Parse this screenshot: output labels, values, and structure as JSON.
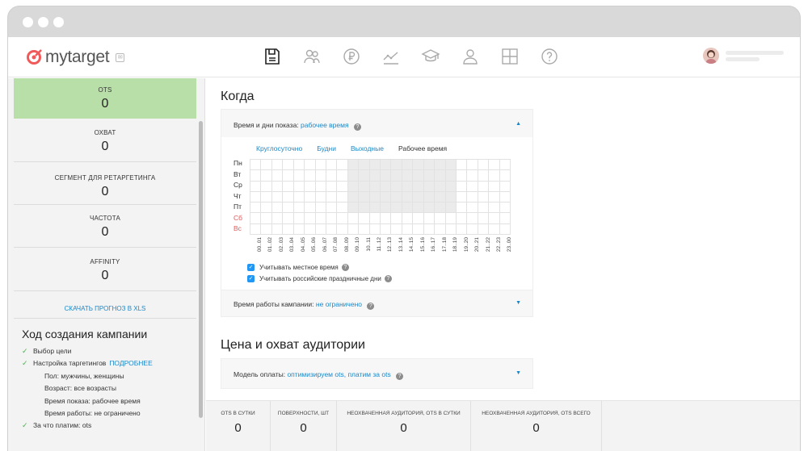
{
  "header": {
    "logo_text": "mytarget",
    "nav_icons": [
      "document-icon",
      "audience-icon",
      "ruble-icon",
      "chart-icon",
      "graduation-cap-icon",
      "profile-icon",
      "layout-icon",
      "help-icon"
    ]
  },
  "colors": {
    "accent": "#1e88c7",
    "active_stat": "#b9dfa8",
    "logo": "#f05a5a",
    "weekend": "#e05a5a"
  },
  "sidebar": {
    "stats": [
      {
        "label": "OTS",
        "value": "0"
      },
      {
        "label": "ОХВАТ",
        "value": "0"
      },
      {
        "label": "СЕГМЕНТ ДЛЯ РЕТАРГЕТИНГА",
        "value": "0"
      },
      {
        "label": "ЧАСТОТА",
        "value": "0"
      },
      {
        "label": "AFFINITY",
        "value": "0"
      }
    ],
    "download_link": "СКАЧАТЬ ПРОГНОЗ В XLS",
    "progress_title": "Ход создания кампании",
    "steps": [
      {
        "text": "Выбор цели",
        "checked": true
      },
      {
        "text": "Настройка таргетингов",
        "link": "ПОДРОБНЕЕ",
        "checked": true
      },
      {
        "text": "Пол: мужчины, женщины"
      },
      {
        "text": "Возраст: все возрасты"
      },
      {
        "text": "Время показа: рабочее время"
      },
      {
        "text": "Время работы: не ограничено"
      },
      {
        "text": "За что платим: ots",
        "checked": true
      }
    ]
  },
  "main": {
    "when_title": "Когда",
    "schedule": {
      "label": "Время и дни показа:",
      "value": "рабочее время",
      "presets": [
        "Круглосуточно",
        "Будни",
        "Выходные",
        "Рабочее время"
      ],
      "days": [
        "Пн",
        "Вт",
        "Ср",
        "Чт",
        "Пт",
        "Сб",
        "Вс"
      ],
      "hours": [
        "00..01",
        "01..02",
        "02..03",
        "03..04",
        "04..05",
        "05..06",
        "06..07",
        "07..08",
        "08..09",
        "09..10",
        "10..11",
        "11..12",
        "12..13",
        "13..14",
        "14..15",
        "15..16",
        "16..17",
        "17..18",
        "18..19",
        "19..20",
        "20..21",
        "21..22",
        "22..23",
        "23..00"
      ],
      "selected_days": [
        0,
        1,
        2,
        3,
        4
      ],
      "selected_hours": [
        9,
        10,
        11,
        12,
        13,
        14,
        15,
        16,
        17,
        18
      ],
      "local_time_label": "Учитывать местное время",
      "holidays_label": "Учитывать российские праздничные дни"
    },
    "campaign_time": {
      "label": "Время работы кампании:",
      "value": "не ограничено"
    },
    "price_title": "Цена и охват аудитории",
    "payment": {
      "label": "Модель оплаты:",
      "value": "оптимизируем ots, платим за ots"
    }
  },
  "footer": {
    "cells": [
      {
        "label": "OTS В СУТКИ",
        "value": "0"
      },
      {
        "label": "ПОВЕРХНОСТИ, ШТ",
        "value": "0"
      },
      {
        "label": "НЕОХВАЧЕННАЯ АУДИТОРИЯ, OTS В СУТКИ",
        "value": "0"
      },
      {
        "label": "НЕОХВАЧЕННАЯ АУДИТОРИЯ, OTS ВСЕГО",
        "value": "0"
      }
    ]
  }
}
